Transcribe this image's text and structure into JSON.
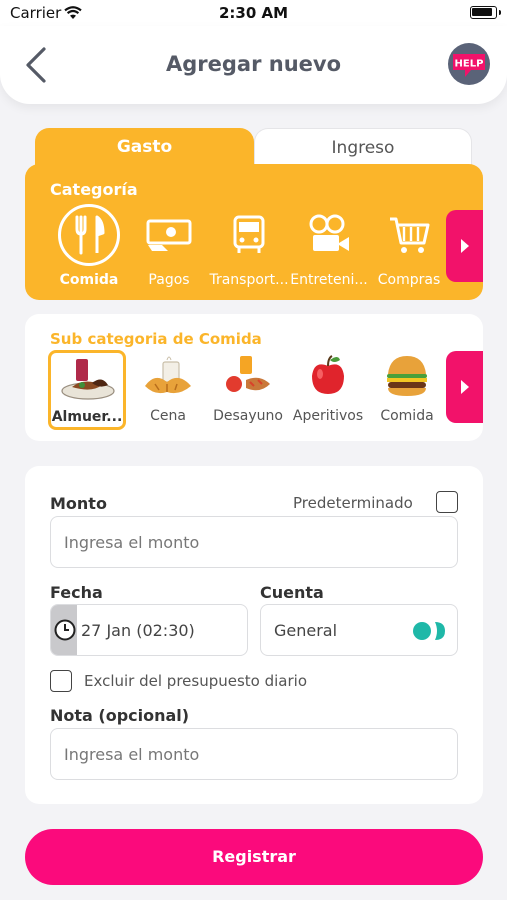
{
  "status": {
    "carrier": "Carrier",
    "time": "2:30 AM"
  },
  "header": {
    "title": "Agregar nuevo",
    "help_label": "HELP"
  },
  "tabs": [
    {
      "label": "Gasto",
      "active": true
    },
    {
      "label": "Ingreso",
      "active": false
    }
  ],
  "categoria": {
    "title": "Categoría",
    "items": [
      {
        "label": "Comida",
        "icon": "cutlery-icon",
        "selected": true
      },
      {
        "label": "Pagos",
        "icon": "money-hand-icon"
      },
      {
        "label": "Transport...",
        "icon": "bus-icon"
      },
      {
        "label": "Entreteni...",
        "icon": "film-camera-icon"
      },
      {
        "label": "Compras",
        "icon": "shopping-cart-icon"
      }
    ]
  },
  "subcategoria": {
    "title": "Sub categoria de Comida",
    "items": [
      {
        "label": "Almuer...",
        "icon": "lunch-plate-icon",
        "selected": true
      },
      {
        "label": "Cena",
        "icon": "coffee-croissant-icon"
      },
      {
        "label": "Desayuno",
        "icon": "breakfast-icon"
      },
      {
        "label": "Aperitivos",
        "icon": "apple-icon"
      },
      {
        "label": "Comida",
        "icon": "burger-icon"
      }
    ]
  },
  "form": {
    "monto_label": "Monto",
    "predeterminado_label": "Predeterminado",
    "monto_placeholder": "Ingresa el monto",
    "fecha_label": "Fecha",
    "fecha_value": "27 Jan (02:30)",
    "cuenta_label": "Cuenta",
    "cuenta_value": "General",
    "excluir_label": "Excluir del presupuesto diario",
    "nota_label": "Nota (opcional)",
    "nota_placeholder": "Ingresa el monto"
  },
  "submit_label": "Registrar",
  "colors": {
    "accent": "#fbb52a",
    "pink": "#fb0a7c",
    "teal": "#1fb8a8"
  }
}
